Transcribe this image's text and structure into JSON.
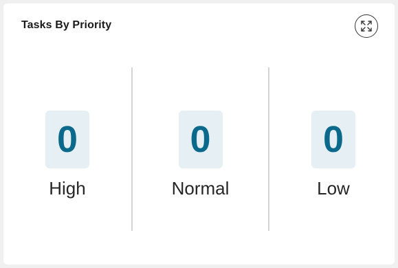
{
  "card": {
    "title": "Tasks By Priority",
    "expand_icon": "expand-icon"
  },
  "priorities": [
    {
      "label": "High",
      "count": "0"
    },
    {
      "label": "Normal",
      "count": "0"
    },
    {
      "label": "Low",
      "count": "0"
    }
  ],
  "colors": {
    "count_text": "#0b6a8c",
    "count_bg": "#e6eff3",
    "divider": "#d4d4d4"
  }
}
